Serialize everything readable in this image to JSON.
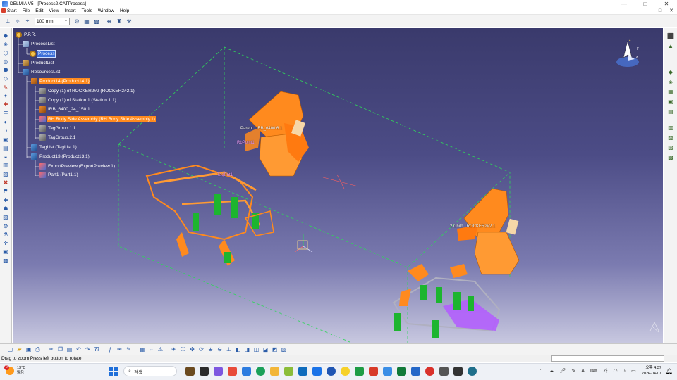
{
  "window": {
    "title": "DELMIA V5 - [Process2.CATProcess]",
    "controls": [
      "—",
      "□",
      "✕"
    ]
  },
  "menu": {
    "items": [
      "Start",
      "File",
      "Edit",
      "View",
      "Insert",
      "Tools",
      "Window",
      "Help"
    ],
    "inner_controls": [
      "—",
      "□",
      "✕"
    ]
  },
  "toolbar": {
    "zoom_value": "100 mm"
  },
  "tree": {
    "nodes": [
      {
        "label": "P.P.R."
      },
      {
        "label": "ProcessList"
      },
      {
        "label": "Process"
      },
      {
        "label": "ProductList"
      },
      {
        "label": "ResourcesList"
      },
      {
        "label": "Product14 (Product14.1)"
      },
      {
        "label": "Copy (1) of ROCKER2#2 (ROCKER2#2.1)"
      },
      {
        "label": "Copy (1) of Station 1 (Station 1.1)"
      },
      {
        "label": "IRB_6400_24_150.1"
      },
      {
        "label": "RH Body Side Assembly (RH Body Side Assembly.1)"
      },
      {
        "label": "TagGroup.1.1"
      },
      {
        "label": "TagGroup.2.1"
      },
      {
        "label": "TagList (TagList.1)"
      },
      {
        "label": "Product13 (Product13.1)"
      },
      {
        "label": "ExportPreview (ExportPreview.1)"
      },
      {
        "label": "Part1 (Part1.1)"
      }
    ]
  },
  "scene": {
    "label_parent": "Parent : IRB_6400.6.1",
    "label_point": "RbPoint1",
    "label_child": "2 Child : ROCKER2#2.1",
    "label_tag": "TagPnt1",
    "compass_axes": [
      "x",
      "y",
      "z"
    ]
  },
  "status": {
    "text": "Drag to zoom  Press left button to rotate"
  },
  "taskbar": {
    "weather_temp": "13°C",
    "weather_cond": "맑음",
    "weather_badge": "2",
    "search_placeholder": "검색",
    "clock_time": "오후 4:37",
    "clock_date": "2026-04-07",
    "ime": "가",
    "lang": "A"
  },
  "colors": {
    "viewport_top": "#3a3a6c",
    "viewport_bottom": "#c8c8e0",
    "selection_orange": "#ff8a1e",
    "selection_blue": "#3a6ed9",
    "robot_orange": "#ff8a1e",
    "fixture_green": "#1db52f",
    "panel_purple": "#b35bff"
  },
  "icons": {
    "search": "search-icon",
    "zoom": "zoom-icon",
    "compass": "compass-icon"
  }
}
